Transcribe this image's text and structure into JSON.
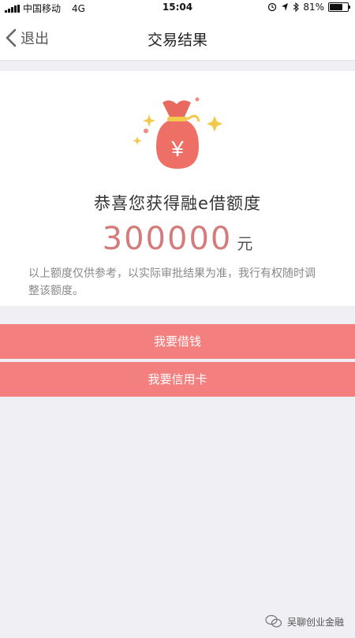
{
  "status_bar": {
    "carrier": "中国移动",
    "network": "4G",
    "time": "15:04",
    "battery": "81%",
    "battery_level": 0.81
  },
  "nav": {
    "back_label": "退出",
    "title": "交易结果"
  },
  "result": {
    "congrats": "恭喜您获得融e借额度",
    "amount": "300000",
    "unit": "元",
    "note": "以上额度仅供参考，以实际审批结果为准，我行有权随时调整该额度。",
    "bag_symbol": "¥"
  },
  "actions": {
    "borrow_label": "我要借钱",
    "credit_card_label": "我要信用卡"
  },
  "watermark": {
    "text": "吴聊创业金融"
  },
  "colors": {
    "accent": "#f37f7f",
    "amount": "#d47b7b",
    "bag": "#ee6f65",
    "sparkle": "#f2c94c",
    "background": "#efeff4"
  }
}
